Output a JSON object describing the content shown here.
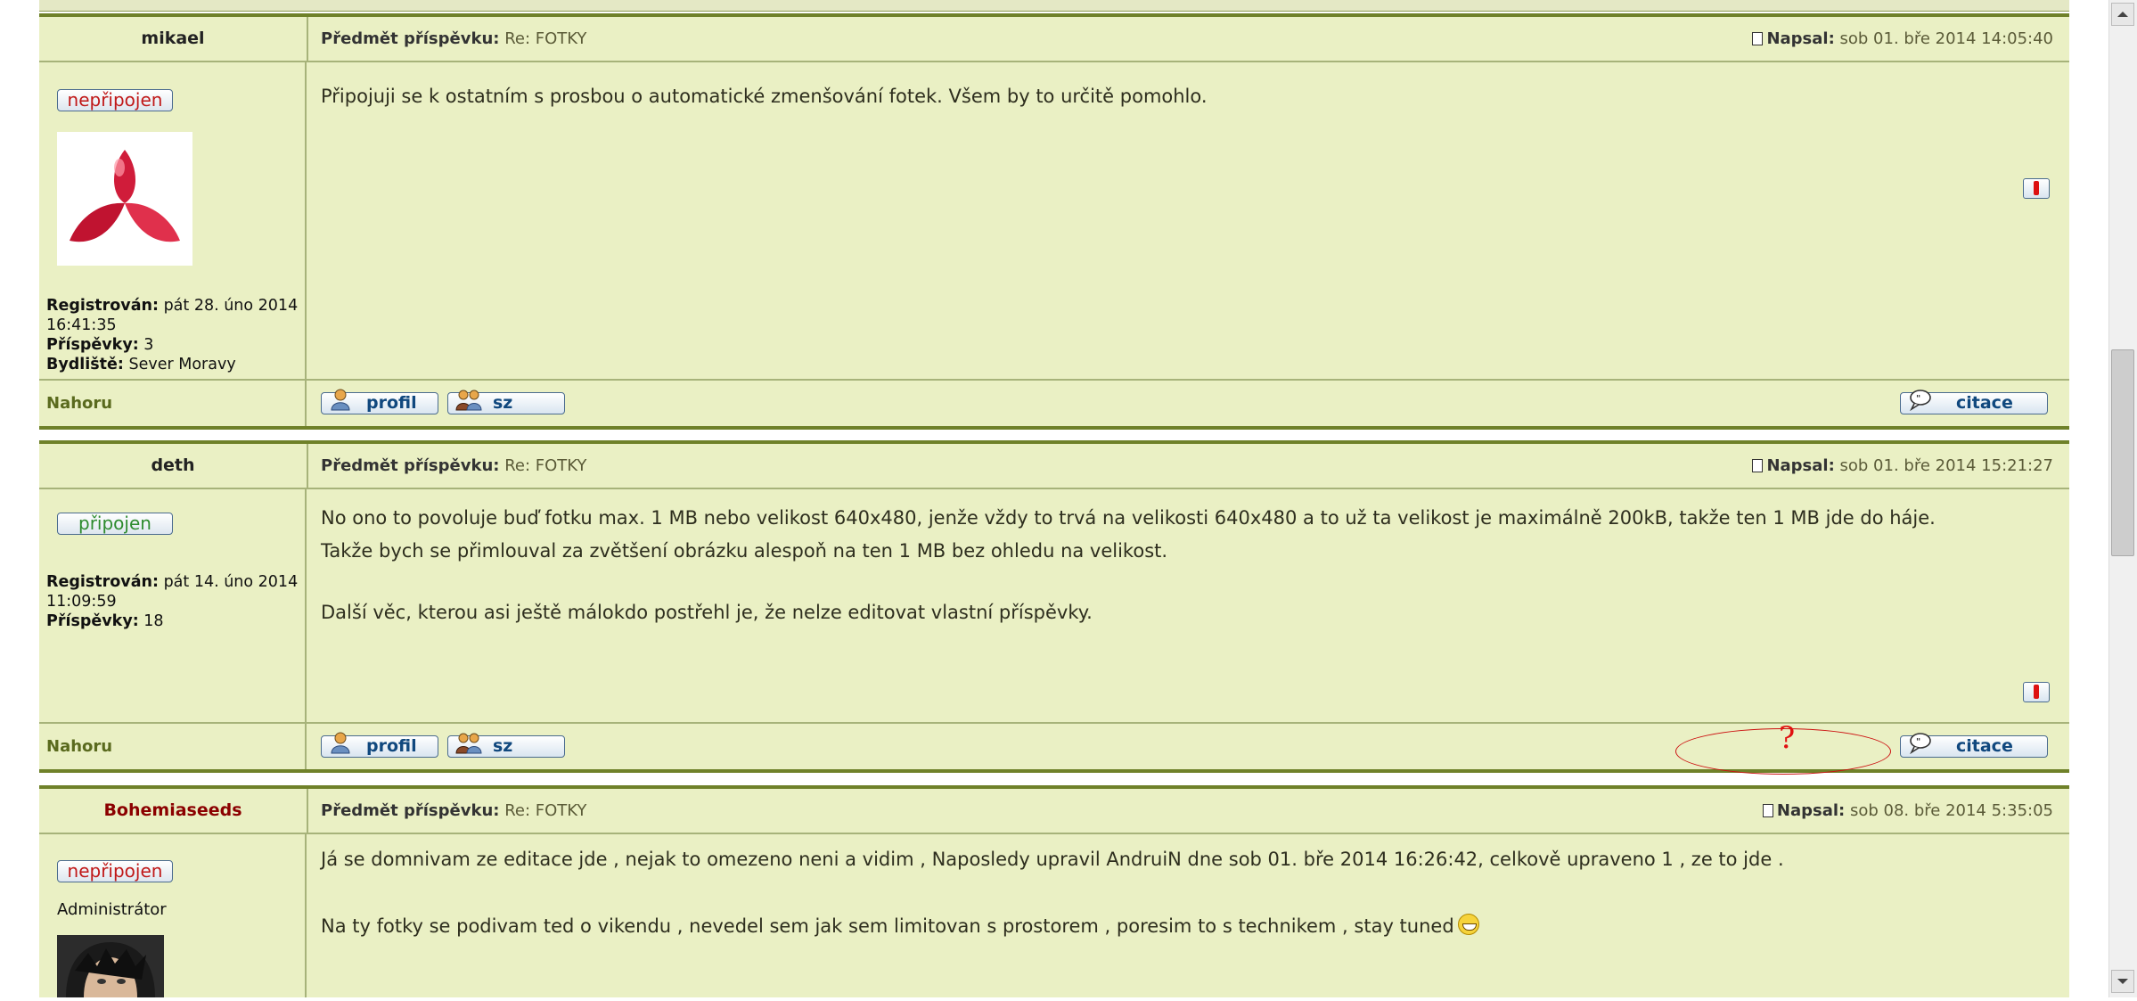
{
  "posts": [
    {
      "author": "mikael",
      "subject_label": "Předmět příspěvku:",
      "subject": "Re: FOTKY",
      "posted_label": "Napsal:",
      "posted": "sob 01. bře 2014 14:05:40",
      "status": "nepřipojen",
      "registered_label": "Registrován:",
      "registered": "pát 28. úno 2014 16:41:35",
      "posts_label": "Příspěvky:",
      "posts_count": "3",
      "location_label": "Bydliště:",
      "location": "Sever Moravy",
      "text": [
        "Připojuji se k ostatním s prosbou o automatické zmenšování fotek. Všem by to určitě pomohlo."
      ]
    },
    {
      "author": "deth",
      "subject_label": "Předmět příspěvku:",
      "subject": "Re: FOTKY",
      "posted_label": "Napsal:",
      "posted": "sob 01. bře 2014 15:21:27",
      "status": "připojen",
      "registered_label": "Registrován:",
      "registered": "pát 14. úno 2014 11:09:59",
      "posts_label": "Příspěvky:",
      "posts_count": "18",
      "text": [
        "No ono to povoluje buď fotku max. 1 MB nebo velikost 640x480, jenže vždy to trvá na velikosti 640x480 a to už ta velikost je maximálně 200kB, takže ten 1 MB jde do háje.",
        "Takže bych se přimlouval za zvětšení obrázku alespoň na ten 1 MB bez ohledu na velikost.",
        "Další věc, kterou asi ještě málokdo postřehl je, že nelze editovat vlastní příspěvky."
      ]
    },
    {
      "author": "Bohemiaseeds",
      "subject_label": "Předmět příspěvku:",
      "subject": "Re: FOTKY",
      "posted_label": "Napsal:",
      "posted": "sob 08. bře 2014 5:35:05",
      "status": "nepřipojen",
      "role": "Administrátor",
      "text": [
        "Já se domnivam ze editace jde , nejak to omezeno neni a vidim , Naposledy upravil AndruiN dne sob 01. bře 2014 16:26:42, celkově upraveno 1 , ze to jde .",
        "Na ty fotky se podivam ted o vikendu , nevedel sem jak sem limitovan s prostorem , poresim to s technikem , stay tuned"
      ]
    }
  ],
  "footer": {
    "top_link": "Nahoru",
    "profile_label": "profil",
    "pm_label": "sz",
    "quote_label": "citace"
  },
  "annotation": {
    "mark": "?",
    "color": "#e01010"
  },
  "colors": {
    "post_bg": "#eaf0c4",
    "border": "#6f8129",
    "admin": "#8b0000"
  }
}
